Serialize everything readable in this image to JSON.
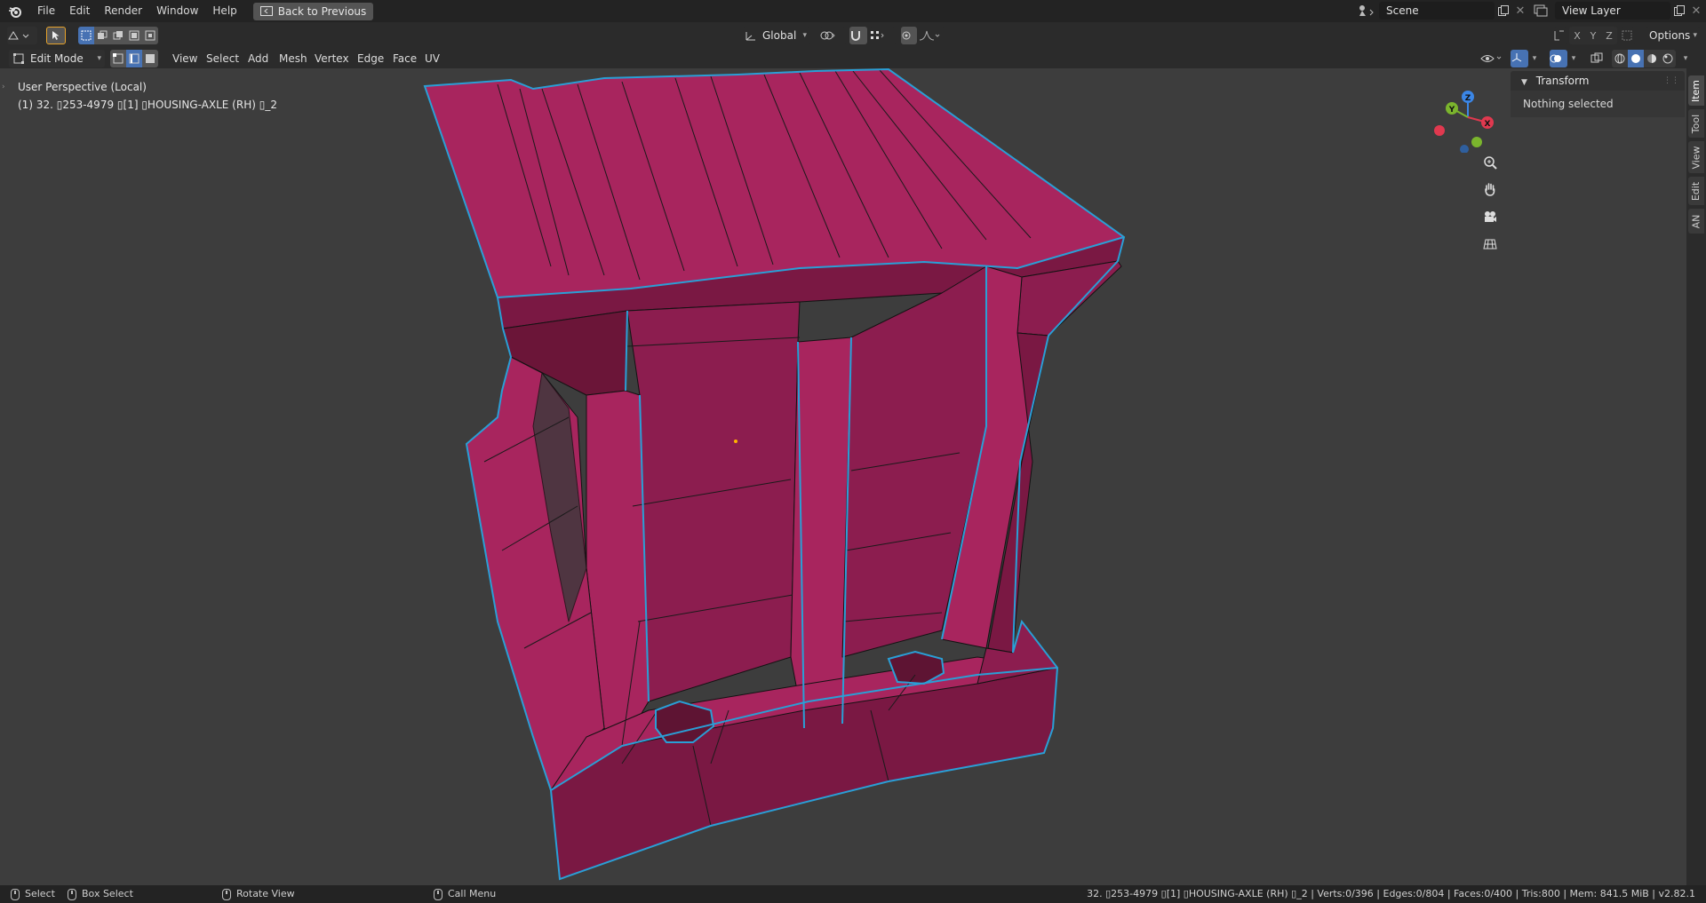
{
  "menubar": {
    "items": [
      "File",
      "Edit",
      "Render",
      "Window",
      "Help"
    ],
    "back_button": "Back to Previous",
    "scene_label": "Scene",
    "view_layer_label": "View Layer"
  },
  "toolheader": {
    "transform_orientation": "Global",
    "axes": [
      "X",
      "Y",
      "Z"
    ],
    "options_label": "Options"
  },
  "modeheader": {
    "mode": "Edit Mode",
    "menus": [
      "View",
      "Select",
      "Add",
      "Mesh",
      "Vertex",
      "Edge",
      "Face",
      "UV"
    ]
  },
  "viewport": {
    "perspective": "User Perspective (Local)",
    "object_info": "(1) 32. ▯253-4979 ▯[1] ▯HOUSING-AXLE (RH) ▯_2",
    "gizmo_axes": [
      "X",
      "Y",
      "Z"
    ]
  },
  "npanel": {
    "section": "Transform",
    "body": "Nothing selected",
    "tabs": [
      "Item",
      "Tool",
      "View",
      "Edit",
      "AN"
    ]
  },
  "statusbar": {
    "select": "Select",
    "box_select": "Box Select",
    "rotate_view": "Rotate View",
    "call_menu": "Call Menu",
    "stats": "32. ▯253-4979 ▯[1] ▯HOUSING-AXLE (RH) ▯_2 | Verts:0/396 | Edges:0/804 | Faces:0/400 | Tris:800 | Mem: 841.5 MiB | v2.82.1"
  },
  "colors": {
    "mesh_face": "#8c1d4f",
    "mesh_face_light": "#a8255e",
    "mesh_face_dark": "#6b1538",
    "mesh_outline": "#2a9fd6",
    "viewport_bg": "#3d3d3d",
    "active_blue": "#4772b3",
    "axis_x": "#e0394f",
    "axis_y": "#7bb52d",
    "axis_z": "#3b86e6"
  }
}
